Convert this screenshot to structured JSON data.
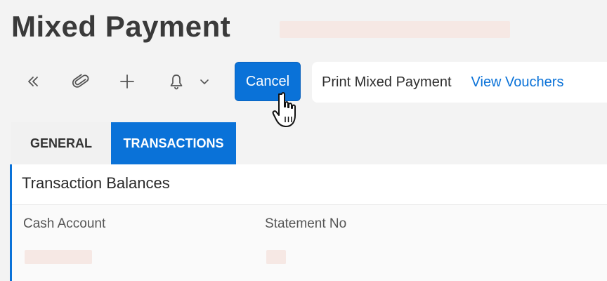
{
  "page": {
    "title": "Mixed Payment"
  },
  "toolbar": {
    "icons": [
      "double-chevron-left-icon",
      "paperclip-icon",
      "plus-icon",
      "bell-icon",
      "chevron-down-icon"
    ],
    "cancel_label": "Cancel"
  },
  "actions": {
    "print_label": "Print Mixed Payment",
    "view_vouchers_label": "View Vouchers",
    "link_color": "#0a72d8"
  },
  "tabs": [
    {
      "label": "GENERAL",
      "active": false
    },
    {
      "label": "TRANSACTIONS",
      "active": true
    }
  ],
  "section": {
    "title": "Transaction Balances",
    "fields": [
      {
        "label": "Cash Account"
      },
      {
        "label": "Statement No"
      }
    ]
  },
  "colors": {
    "accent": "#0a72d8",
    "background": "#f3f3f3"
  }
}
